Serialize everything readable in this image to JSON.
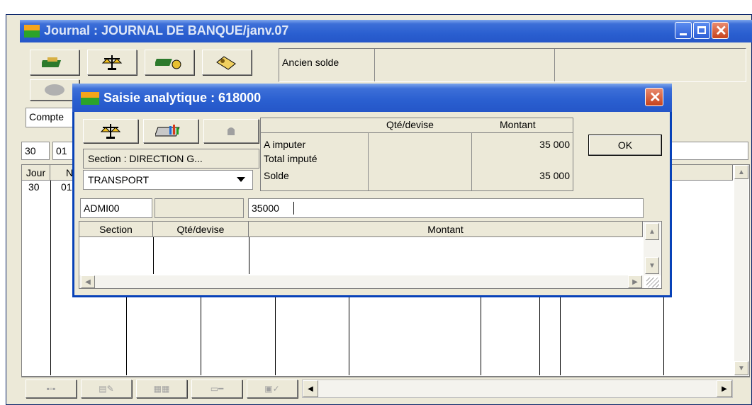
{
  "journal": {
    "title": "Journal : JOURNAL DE BANQUE/janv.07",
    "ancien_solde_label": "Ancien solde",
    "compte_label": "Compte",
    "day_value": "30",
    "num_value_partial": "01",
    "col_jour": "Jour",
    "col_n": "N",
    "row_day": "30",
    "row_num": "01"
  },
  "dialog": {
    "title": "Saisie analytique : 618000",
    "section_label": "Section : DIRECTION G...",
    "axis_select": "TRANSPORT",
    "summary": {
      "headers": {
        "qty": "Qté/devise",
        "amount": "Montant"
      },
      "rows": [
        {
          "label": "A imputer",
          "amount": "35 000"
        },
        {
          "label": "Total imputé",
          "amount": ""
        },
        {
          "label": "Solde",
          "amount": "35 000"
        }
      ]
    },
    "ok_label": "OK",
    "entry": {
      "section": "ADMI00",
      "qty": "",
      "amount": "35000"
    },
    "grid_headers": {
      "section": "Section",
      "qty": "Qté/devise",
      "amount": "Montant"
    }
  }
}
